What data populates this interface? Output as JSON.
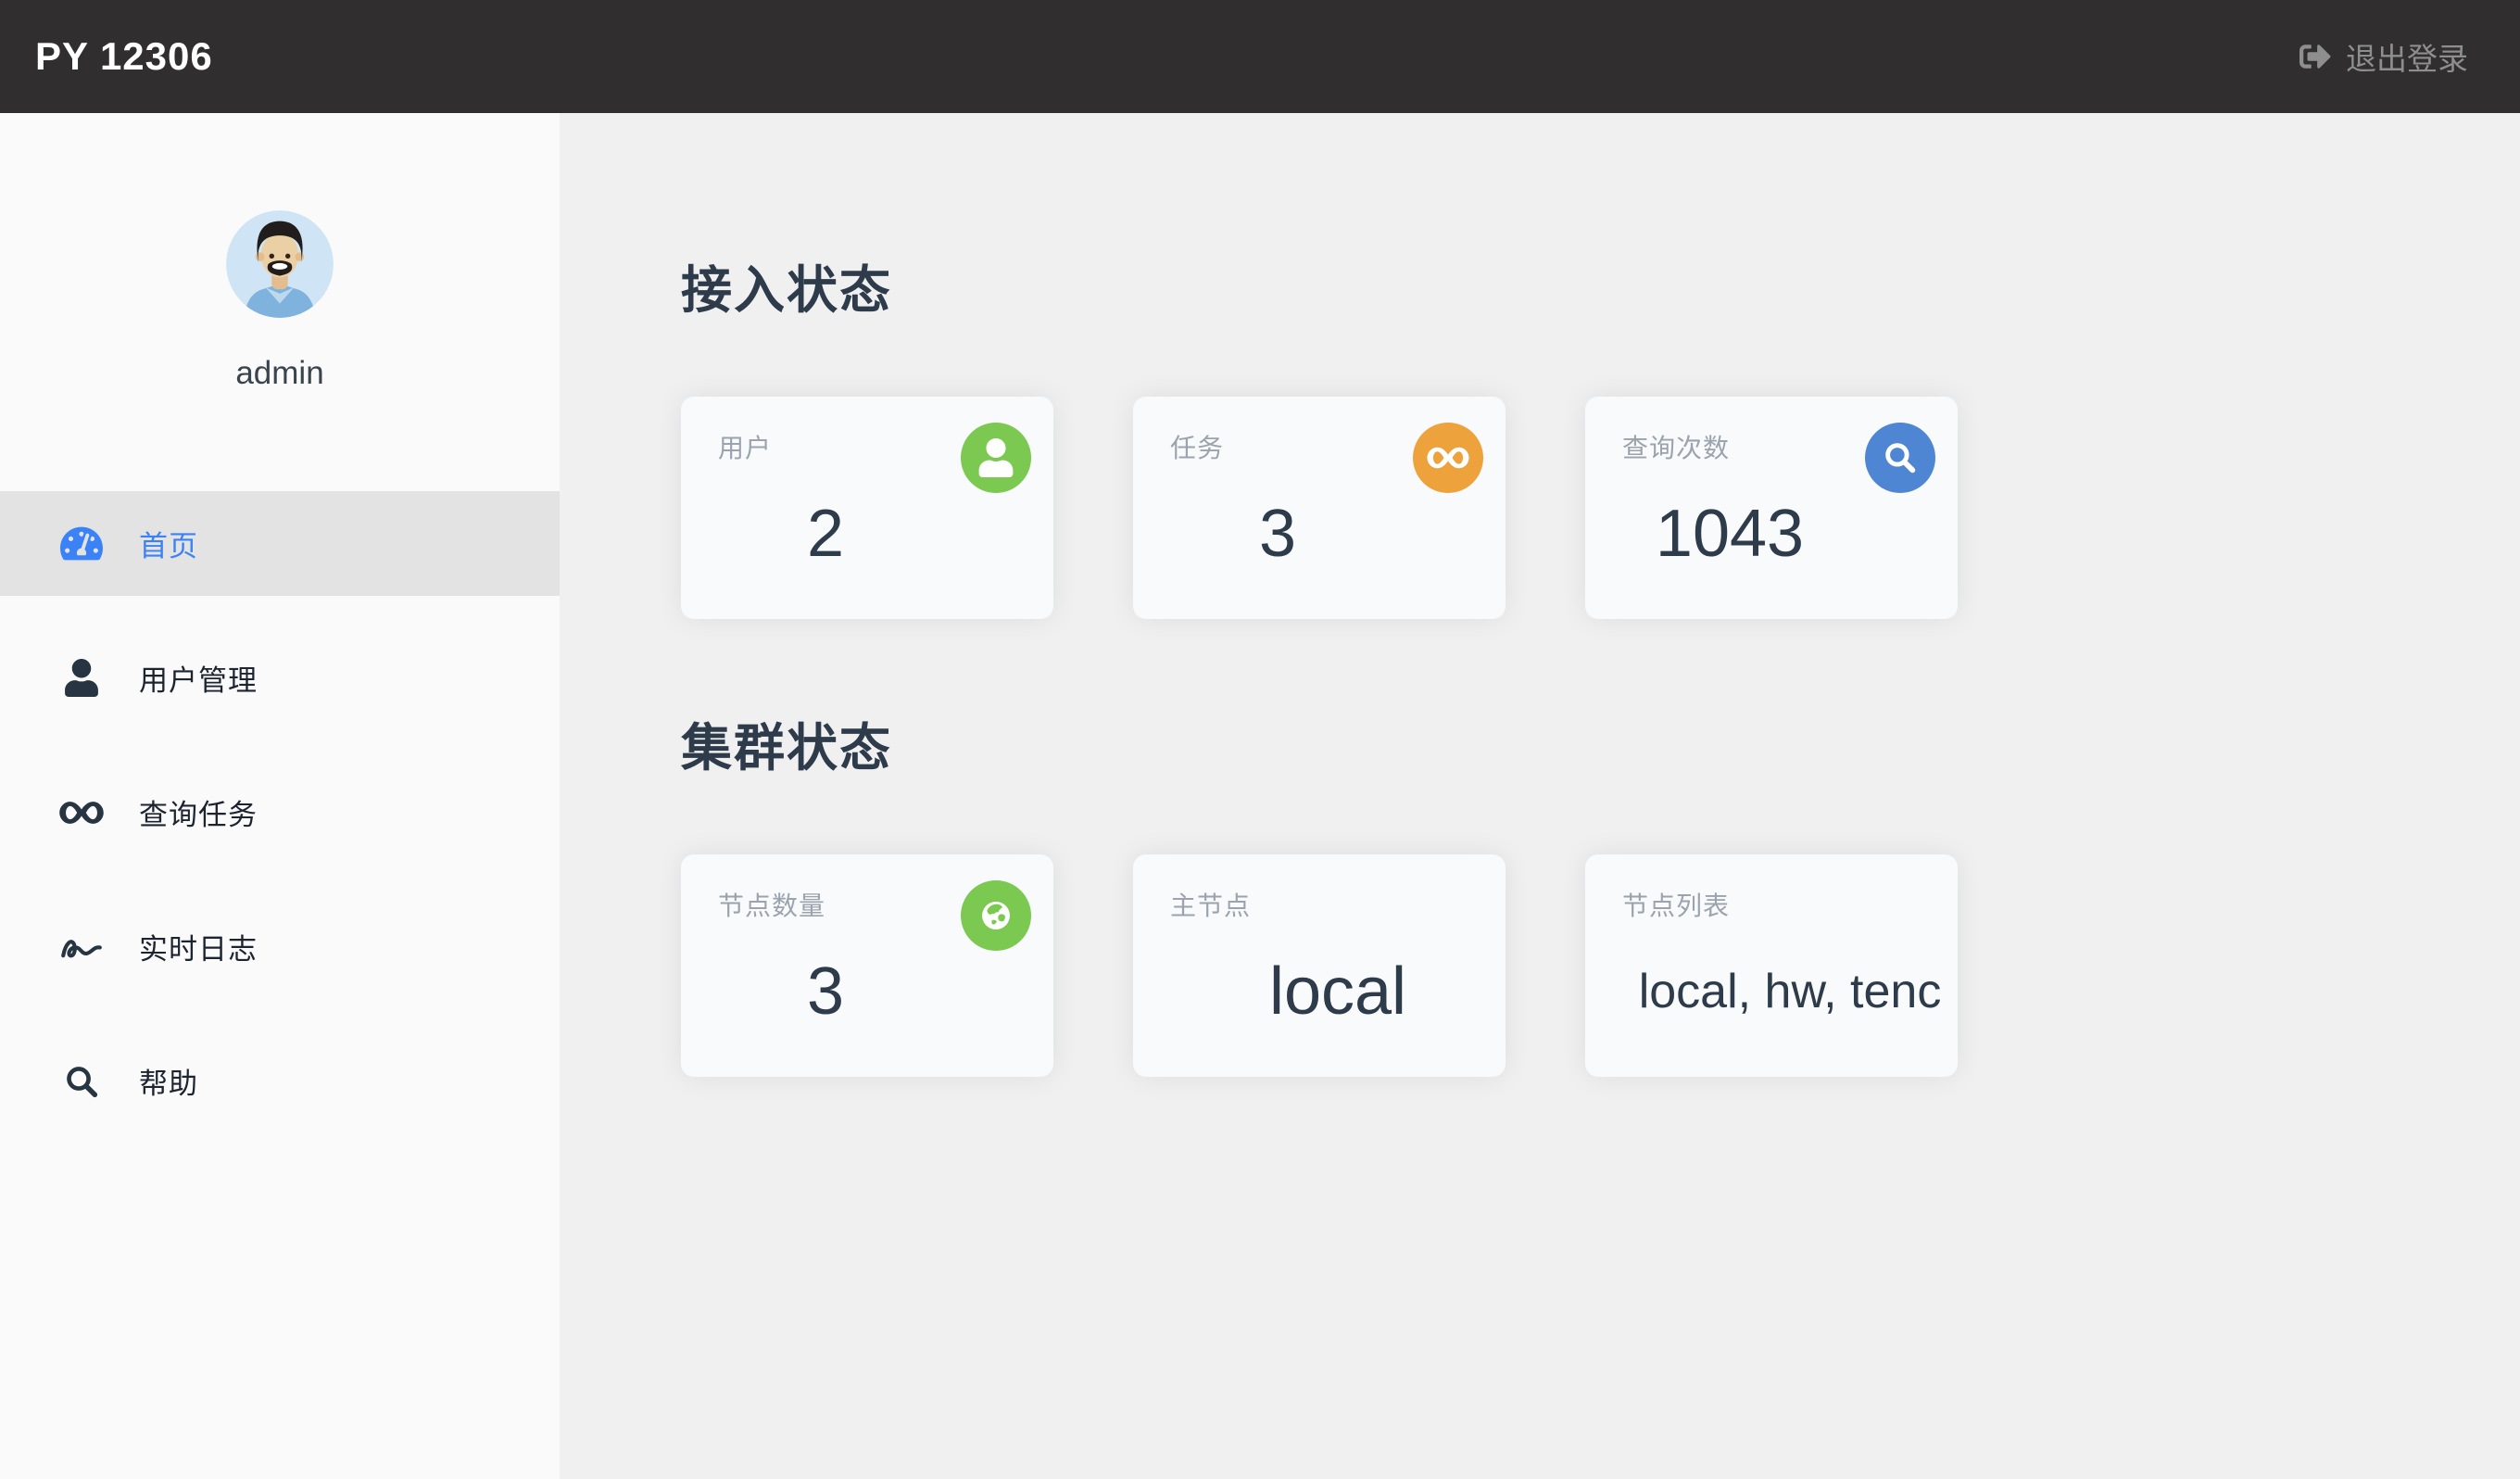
{
  "topbar": {
    "brand": "PY 12306",
    "logout_label": "退出登录",
    "logout_icon": "sign-out-icon",
    "bg_color": "#302e2f"
  },
  "sidebar": {
    "username": "admin",
    "avatar": "man-avatar",
    "items": [
      {
        "label": "首页",
        "icon": "tachometer-icon",
        "active": true
      },
      {
        "label": "用户管理",
        "icon": "user-icon",
        "active": false
      },
      {
        "label": "查询任务",
        "icon": "infinity-icon",
        "active": false
      },
      {
        "label": "实时日志",
        "icon": "signature-icon",
        "active": false
      },
      {
        "label": "帮助",
        "icon": "search-icon",
        "active": false
      }
    ]
  },
  "sections": [
    {
      "title": "接入状态",
      "cards": [
        {
          "label": "用户",
          "value": "2",
          "icon": "user-icon",
          "badge_color": "#7bc950"
        },
        {
          "label": "任务",
          "value": "3",
          "icon": "infinity-icon",
          "badge_color": "#eea23b"
        },
        {
          "label": "查询次数",
          "value": "1043",
          "icon": "search-icon",
          "badge_color": "#4e86d4"
        }
      ]
    },
    {
      "title": "集群状态",
      "cards": [
        {
          "label": "节点数量",
          "value": "3",
          "icon": "globe-icon",
          "badge_color": "#7bc950"
        },
        {
          "label": "主节点",
          "value": "local"
        },
        {
          "label": "节点列表",
          "value": "local, hw, tenc"
        }
      ]
    }
  ],
  "colors": {
    "topbar_bg": "#302e2f",
    "page_bg": "#f0f0f1",
    "sidebar_bg": "#fafafa",
    "active_item_bg": "#e3e3e4",
    "accent_blue": "#3b82f6",
    "badge_green": "#7bc950",
    "badge_orange": "#eea23b",
    "badge_blue": "#4e86d4",
    "value_text": "#2e3b4a",
    "label_gray": "#9aa3ae",
    "logout_gray": "#8e8e8e"
  }
}
